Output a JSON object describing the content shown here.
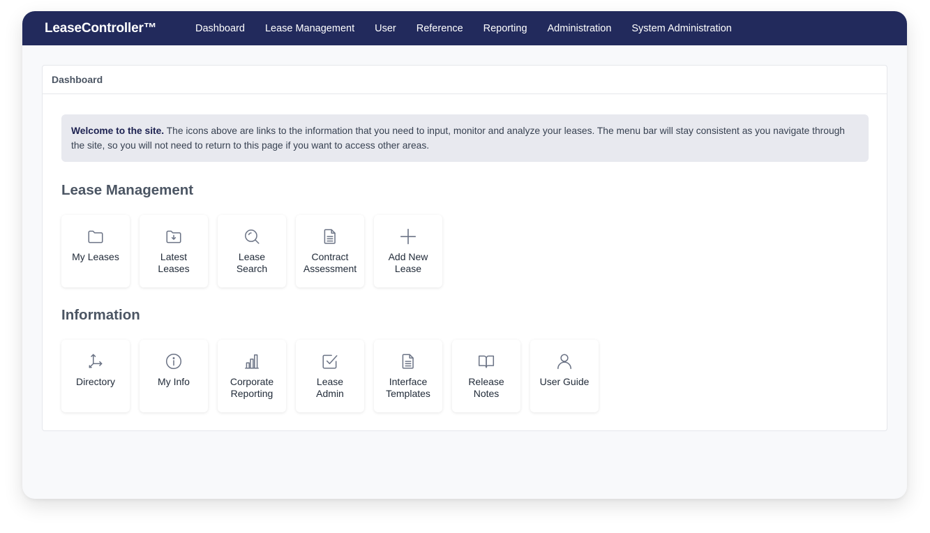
{
  "navbar": {
    "brand": "LeaseController™",
    "items": [
      {
        "label": "Dashboard"
      },
      {
        "label": "Lease Management"
      },
      {
        "label": "User"
      },
      {
        "label": "Reference"
      },
      {
        "label": "Reporting"
      },
      {
        "label": "Administration"
      },
      {
        "label": "System Administration"
      }
    ]
  },
  "card": {
    "header": "Dashboard",
    "welcome": {
      "bold": "Welcome to the site.",
      "text": " The icons above are links to the information that you need to input, monitor and analyze your leases. The menu bar will stay consistent as you navigate through the site, so you will not need to return to this page if you want to access other areas."
    }
  },
  "lease_management": {
    "title": "Lease Management",
    "tiles": [
      {
        "line1": "My Leases",
        "line2": "",
        "icon": "folder-icon"
      },
      {
        "line1": "Latest",
        "line2": "Leases",
        "icon": "folder-download-icon"
      },
      {
        "line1": "Lease",
        "line2": "Search",
        "icon": "search-icon"
      },
      {
        "line1": "Contract",
        "line2": "Assessment",
        "icon": "document-icon"
      },
      {
        "line1": "Add New",
        "line2": "Lease",
        "icon": "plus-icon"
      }
    ]
  },
  "information": {
    "title": "Information",
    "tiles": [
      {
        "line1": "Directory",
        "line2": "",
        "icon": "directory-arrows-icon"
      },
      {
        "line1": "My Info",
        "line2": "",
        "icon": "info-circle-icon"
      },
      {
        "line1": "Corporate",
        "line2": "Reporting",
        "icon": "bar-chart-icon"
      },
      {
        "line1": "Lease",
        "line2": "Admin",
        "icon": "checkbox-icon"
      },
      {
        "line1": "Interface",
        "line2": "Templates",
        "icon": "document-icon"
      },
      {
        "line1": "Release",
        "line2": "Notes",
        "icon": "book-icon"
      },
      {
        "line1": "User Guide",
        "line2": "",
        "icon": "user-icon"
      }
    ]
  },
  "colors": {
    "navbar": "#222a5c",
    "welcome_bg": "#e8e9ef",
    "icon": "#6b7385"
  }
}
